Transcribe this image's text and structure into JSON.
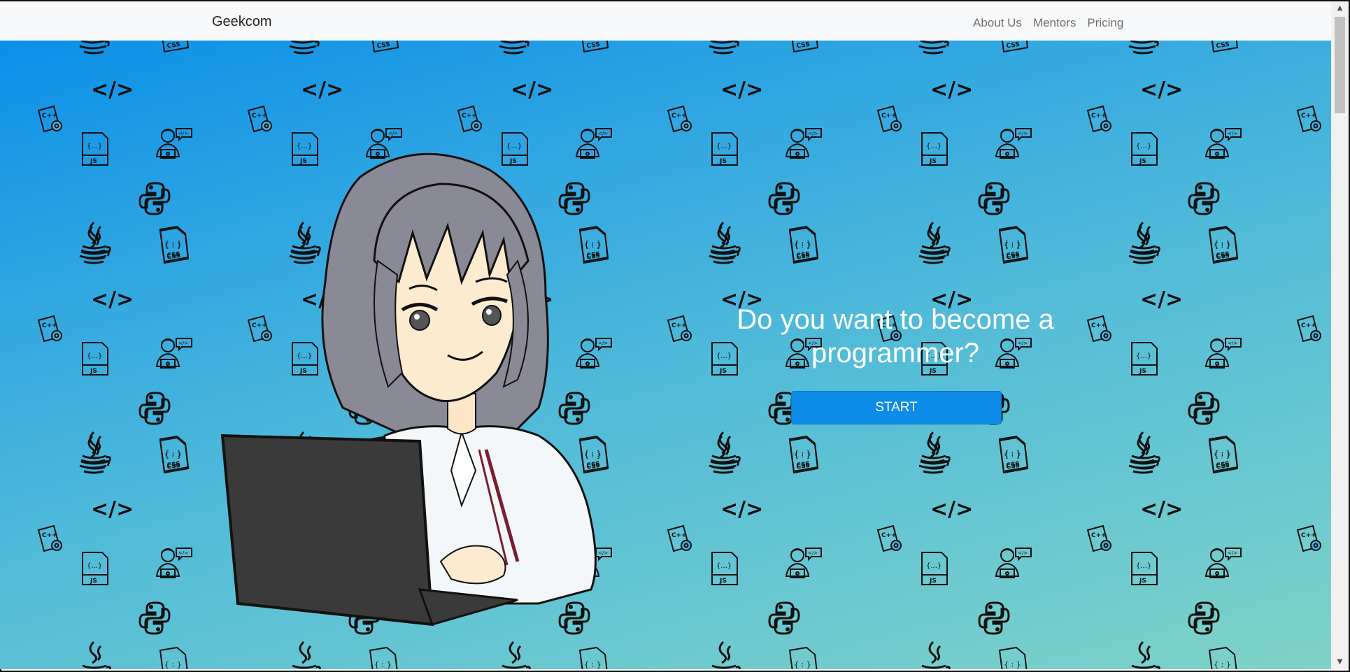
{
  "navbar": {
    "brand": "Geekcom",
    "links": [
      "About Us",
      "Mentors",
      "Pricing"
    ]
  },
  "hero": {
    "headline_line1": "Do you want to become a",
    "headline_line2": "programmer?",
    "cta_label": "START"
  },
  "pattern_icons": [
    "code-tag-icon",
    "cpp-file-icon",
    "js-file-icon",
    "developer-icon",
    "python-icon",
    "java-icon",
    "css-file-icon"
  ],
  "colors": {
    "navbar_bg": "#f8f9fa",
    "gradient_top": "#0a8fe8",
    "gradient_bottom": "#7fd3c8",
    "button_bg": "#0d8ce8",
    "headline_text": "#ffffff"
  }
}
